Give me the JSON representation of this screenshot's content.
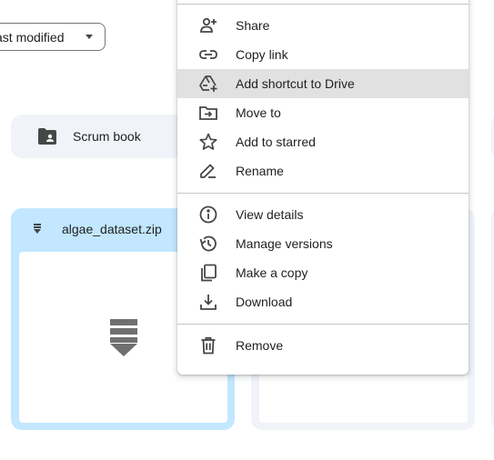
{
  "toolbar": {
    "sort_label": "ast modified",
    "sort_icon": "chevron-down-icon"
  },
  "folders": [
    {
      "label": "Scrum book",
      "icon": "folder-icon"
    }
  ],
  "files": [
    {
      "name": "algae_dataset.zip",
      "icon": "zip-icon",
      "selected": true
    }
  ],
  "menu": {
    "items": [
      {
        "label": "Share",
        "icon": "person-add-icon"
      },
      {
        "label": "Copy link",
        "icon": "link-icon"
      },
      {
        "label": "Add shortcut to Drive",
        "icon": "add-to-drive-icon",
        "highlighted": true
      },
      {
        "label": "Move to",
        "icon": "move-to-folder-icon"
      },
      {
        "label": "Add to starred",
        "icon": "star-icon"
      },
      {
        "label": "Rename",
        "icon": "pencil-icon"
      },
      {
        "label": "View details",
        "icon": "info-icon"
      },
      {
        "label": "Manage versions",
        "icon": "history-icon"
      },
      {
        "label": "Make a copy",
        "icon": "copy-icon"
      },
      {
        "label": "Download",
        "icon": "download-icon"
      },
      {
        "label": "Remove",
        "icon": "trash-icon"
      }
    ]
  },
  "colors": {
    "selected_card": "#c2e7ff",
    "card_bg": "#f0f4f9",
    "menu_highlight": "#e1e1e1",
    "icon": "#444746",
    "text": "#1f1f1f"
  }
}
